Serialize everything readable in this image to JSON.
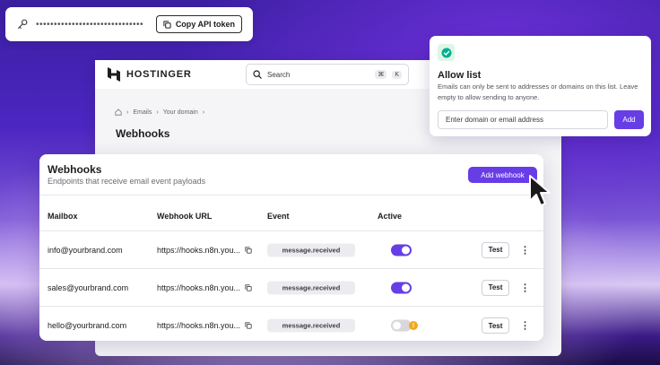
{
  "token": {
    "masked_value": "••••••••••••••••••••••••••••••",
    "copy_label": "Copy API token"
  },
  "dashboard": {
    "brand": "HOSTINGER",
    "search": {
      "placeholder": "Search",
      "shortcut_1": "⌘",
      "shortcut_2": "K"
    },
    "breadcrumb": [
      "Emails",
      "Your domain"
    ],
    "title": "Webhooks"
  },
  "webhooks": {
    "title": "Webhooks",
    "subtitle": "Endpoints that receive email event payloads",
    "add_label": "Add webhook",
    "columns": {
      "mailbox": "Mailbox",
      "url": "Webhook URL",
      "event": "Event",
      "active": "Active"
    },
    "rows": [
      {
        "mailbox": "info@yourbrand.com",
        "url": "https://hooks.n8n.you...",
        "event": "message.received",
        "active": true,
        "test_label": "Test"
      },
      {
        "mailbox": "sales@yourbrand.com",
        "url": "https://hooks.n8n.you...",
        "event": "message.received",
        "active": true,
        "test_label": "Test"
      },
      {
        "mailbox": "hello@yourbrand.com",
        "url": "https://hooks.n8n.you...",
        "event": "message.received",
        "active": false,
        "warning": "!",
        "test_label": "Test"
      }
    ]
  },
  "allow_list": {
    "title": "Allow list",
    "description": "Emails can only be sent to addresses or domains on this list. Leave empty to allow sending to anyone.",
    "input_placeholder": "Enter domain or email address",
    "add_label": "Add"
  },
  "colors": {
    "accent": "#673de6",
    "warning": "#f3a81a",
    "success": "#00b090"
  }
}
